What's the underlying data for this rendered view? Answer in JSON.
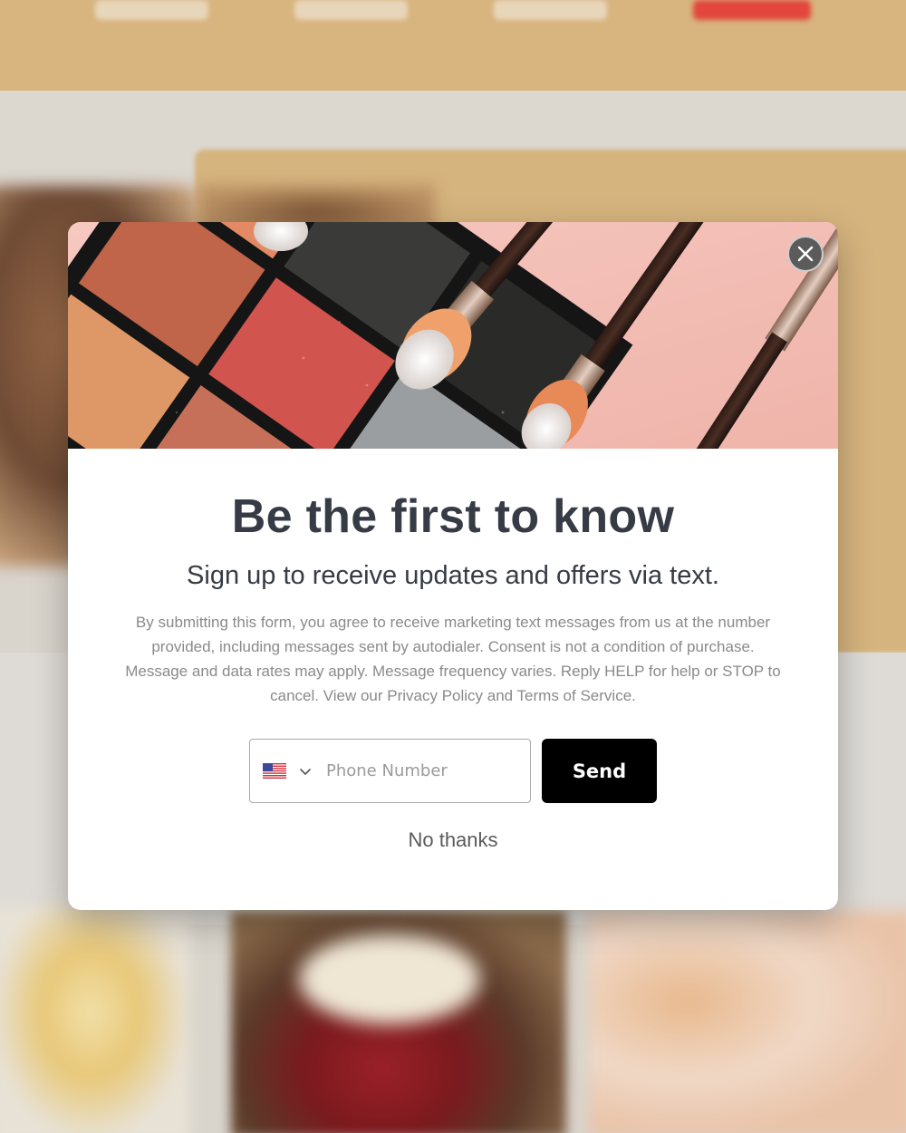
{
  "popup": {
    "title": "Be the first to know",
    "subtitle": "Sign up to receive updates and offers via text.",
    "legal_text": "By submitting this form, you agree to receive marketing text messages from us at the number provided, including messages sent by autodialer. Consent is not a condition of purchase. Message and data rates may apply. Message frequency varies. Reply HELP for help or STOP to cancel. View our Privacy Policy and Terms of Service.",
    "phone_placeholder": "Phone Number",
    "phone_value": "",
    "send_label": "Send",
    "no_thanks_label": "No thanks",
    "close_icon": "close-icon",
    "country_flag_icon": "us-flag-icon",
    "country_dropdown_icon": "chevron-down-icon",
    "hero_image": "eyeshadow-palette-with-brushes"
  },
  "colors": {
    "title": "#363b45",
    "legal": "#8a8a8a",
    "send_button": "#000000",
    "close_button": "#5b5b5b"
  }
}
